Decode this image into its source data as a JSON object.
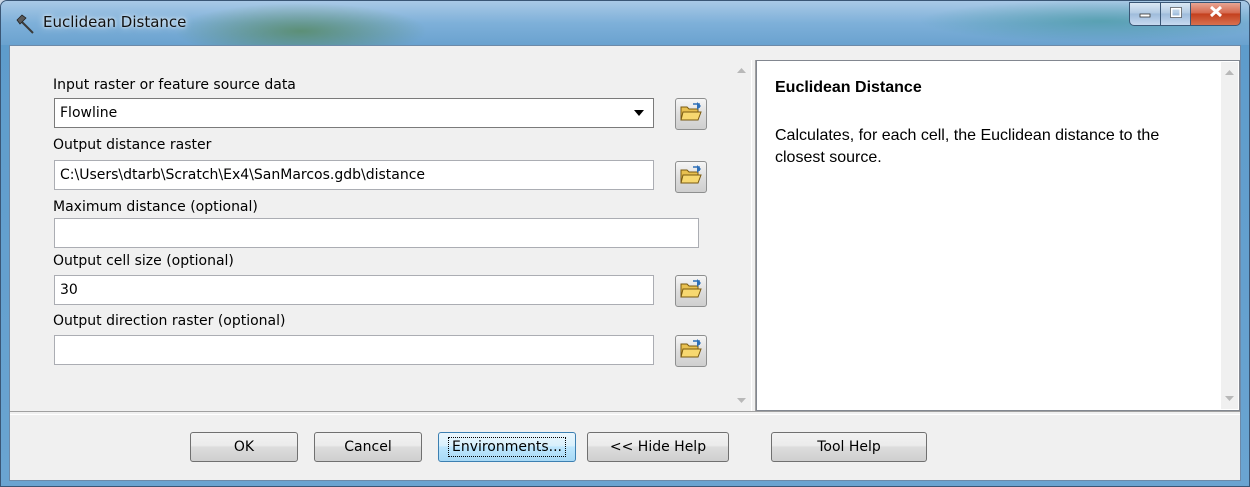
{
  "window": {
    "title": "Euclidean Distance",
    "icon": "hammer-tool-icon",
    "controls": {
      "minimize": "minimize-icon",
      "maximize": "maximize-icon",
      "close": "close-icon"
    }
  },
  "form": {
    "input_source": {
      "label": "Input raster or feature source data",
      "value": "Flowline"
    },
    "output_distance": {
      "label": "Output distance raster",
      "value": "C:\\Users\\dtarb\\Scratch\\Ex4\\SanMarcos.gdb\\distance"
    },
    "max_distance": {
      "label": "Maximum distance (optional)",
      "value": ""
    },
    "cell_size": {
      "label": "Output cell size (optional)",
      "value": "30"
    },
    "direction_raster": {
      "label": "Output direction raster (optional)",
      "value": ""
    }
  },
  "help": {
    "title": "Euclidean Distance",
    "body": "Calculates, for each cell, the Euclidean distance to the closest source."
  },
  "buttons": {
    "ok": "OK",
    "cancel": "Cancel",
    "environments": "Environments...",
    "hide_help": "<< Hide Help",
    "tool_help": "Tool Help"
  },
  "colors": {
    "title_bar": "#7eb0d9",
    "close_button": "#c4401e",
    "focus_border": "#3c7fb1"
  }
}
